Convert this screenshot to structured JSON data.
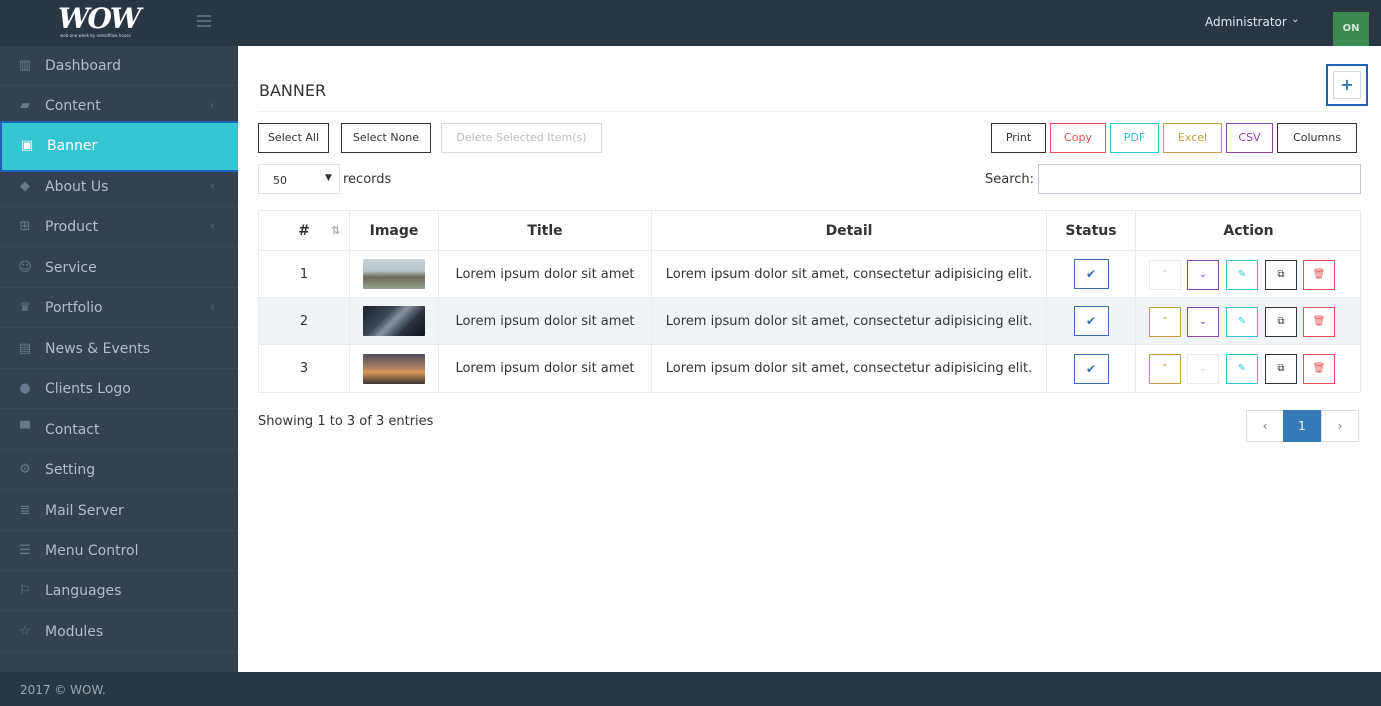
{
  "brand": {
    "logo": "WOW",
    "tagline": "web-one week by netsoftlive house"
  },
  "topbar": {
    "user": "Administrator",
    "user_caret": "⌄",
    "logout": "ON"
  },
  "sidebar": {
    "items": [
      {
        "label": "Dashboard",
        "icon": "bar-chart-icon",
        "glyph": "▥"
      },
      {
        "label": "Content",
        "icon": "book-icon",
        "glyph": "▰",
        "arrow": "‹"
      },
      {
        "label": "Banner",
        "icon": "image-icon",
        "glyph": "▣"
      },
      {
        "label": "About Us",
        "icon": "tags-icon",
        "glyph": "◆",
        "arrow": "‹"
      },
      {
        "label": "Product",
        "icon": "cart-icon",
        "glyph": "⊞",
        "arrow": "‹"
      },
      {
        "label": "Service",
        "icon": "smile-icon",
        "glyph": "☺"
      },
      {
        "label": "Portfolio",
        "icon": "trophy-icon",
        "glyph": "♛",
        "arrow": "‹"
      },
      {
        "label": "News & Events",
        "icon": "newspaper-icon",
        "glyph": "▤"
      },
      {
        "label": "Clients Logo",
        "icon": "circle-logo-icon",
        "glyph": "●"
      },
      {
        "label": "Contact",
        "icon": "archive-icon",
        "glyph": "▀"
      },
      {
        "label": "Setting",
        "icon": "gears-icon",
        "glyph": "⚙"
      },
      {
        "label": "Mail Server",
        "icon": "database-icon",
        "glyph": "≣"
      },
      {
        "label": "Menu Control",
        "icon": "list-icon",
        "glyph": "☰"
      },
      {
        "label": "Languages",
        "icon": "flag-icon",
        "glyph": "⚐"
      },
      {
        "label": "Modules",
        "icon": "star-icon",
        "glyph": "☆"
      }
    ]
  },
  "footer": {
    "text": "2017 © WOW."
  },
  "page": {
    "title": "BANNER",
    "add_glyph": "+"
  },
  "toolbar": {
    "select_all": "Select All",
    "select_none": "Select None",
    "delete_selected": "Delete Selected Item(s)",
    "print": "Print",
    "copy": "Copy",
    "pdf": "PDF",
    "excel": "Excel",
    "csv": "CSV",
    "columns": "Columns"
  },
  "length": {
    "value": "50",
    "label": "records"
  },
  "search": {
    "label": "Search:",
    "value": ""
  },
  "table": {
    "headers": {
      "num": "#",
      "image": "Image",
      "title": "Title",
      "detail": "Detail",
      "status": "Status",
      "action": "Action"
    },
    "rows": [
      {
        "num": "1",
        "title": "Lorem ipsum dolor sit amet",
        "detail": "Lorem ipsum dolor sit amet, consectetur adipisicing elit."
      },
      {
        "num": "2",
        "title": "Lorem ipsum dolor sit amet",
        "detail": "Lorem ipsum dolor sit amet, consectetur adipisicing elit."
      },
      {
        "num": "3",
        "title": "Lorem ipsum dolor sit amet",
        "detail": "Lorem ipsum dolor sit amet, consectetur adipisicing elit."
      }
    ],
    "glyphs": {
      "status": "✔",
      "up": "⌃",
      "down": "⌄",
      "edit": "✎",
      "copy": "⧉",
      "delete": "🗑"
    }
  },
  "info": "Showing 1 to 3 of 3 entries",
  "pagination": {
    "prev": "‹",
    "current": "1",
    "next": "›"
  },
  "colors": {
    "sidebar": "#364150",
    "active": "#36c6d3",
    "primary": "#337ab7"
  }
}
